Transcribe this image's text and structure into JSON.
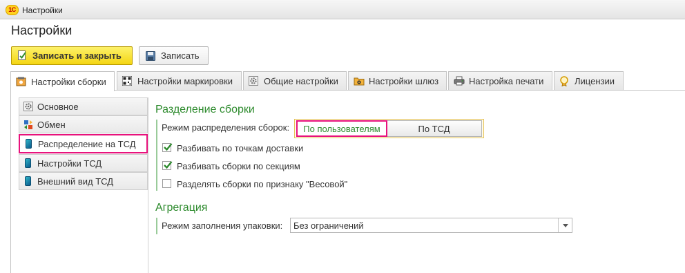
{
  "window": {
    "app_logo": "1С",
    "title": "Настройки"
  },
  "page": {
    "title": "Настройки"
  },
  "toolbar": {
    "save_close_label": "Записать и закрыть",
    "save_label": "Записать"
  },
  "tabs": [
    {
      "label": "Настройки сборки",
      "icon": "assembly-settings-icon",
      "active": true
    },
    {
      "label": "Настройки маркировки",
      "icon": "qr-code-icon"
    },
    {
      "label": "Общие настройки",
      "icon": "gear-icon"
    },
    {
      "label": "Настройки шлюз",
      "icon": "folder-gear-icon"
    },
    {
      "label": "Настройка печати",
      "icon": "printer-icon"
    },
    {
      "label": "Лицензии",
      "icon": "license-icon"
    }
  ],
  "nav": [
    {
      "label": "Основное",
      "icon": "gear-icon"
    },
    {
      "label": "Обмен",
      "icon": "exchange-icon"
    },
    {
      "label": "Распределение на ТСД",
      "icon": "mobile-device-icon",
      "selected": true
    },
    {
      "label": "Настройки ТСД",
      "icon": "mobile-device-icon"
    },
    {
      "label": "Внешний вид ТСД",
      "icon": "mobile-device-icon"
    }
  ],
  "split": {
    "title": "Разделение сборки",
    "mode_label": "Режим распределения сборок:",
    "mode_options": [
      "По пользователям",
      "По ТСД"
    ],
    "mode_selected": "По пользователям",
    "checkboxes": [
      {
        "label": "Разбивать по точкам доставки",
        "checked": true
      },
      {
        "label": "Разбивать сборки по секциям",
        "checked": true
      },
      {
        "label": "Разделять сборки по признаку \"Весовой\"",
        "checked": false
      }
    ]
  },
  "aggregation": {
    "title": "Агрегация",
    "fill_mode_label": "Режим заполнения упаковки:",
    "fill_mode_value": "Без ограничений"
  },
  "colors": {
    "accent_green": "#2e8b2e",
    "highlight_pink": "#e8127c",
    "primary_yellow": "#f4d513"
  }
}
